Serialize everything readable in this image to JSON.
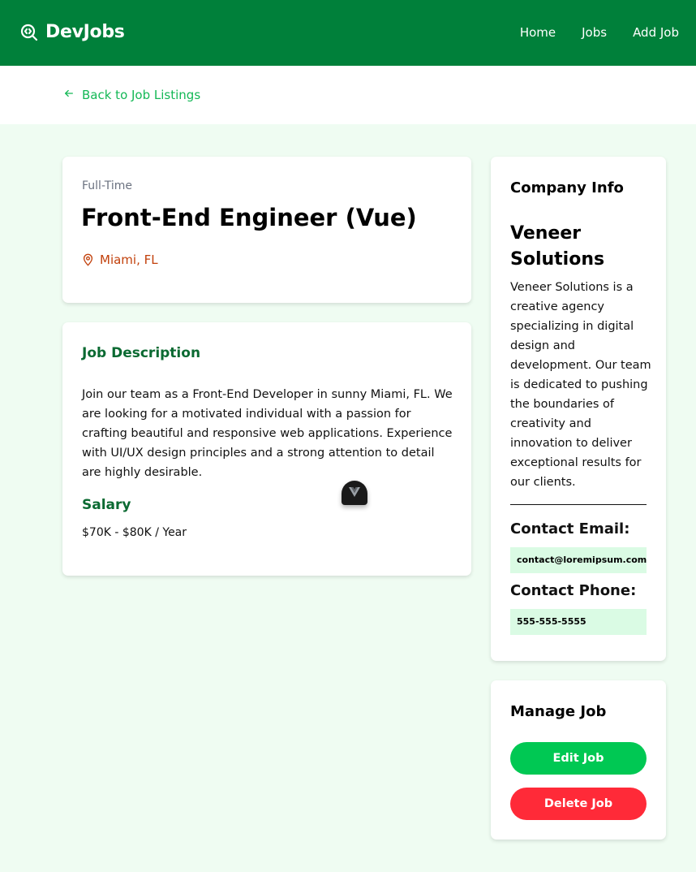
{
  "navbar": {
    "brand": "DevJobs",
    "links": [
      "Home",
      "Jobs",
      "Add Job"
    ]
  },
  "back_link": "Back to Job Listings",
  "job": {
    "type": "Full-Time",
    "title": "Front-End Engineer (Vue)",
    "location": "Miami, FL",
    "description_heading": "Job Description",
    "description": "Join our team as a Front-End Developer in sunny Miami, FL. We are looking for a motivated individual with a passion for crafting beautiful and responsive web applications. Experience with UI/UX design principles and a strong attention to detail are highly desirable.",
    "salary_heading": "Salary",
    "salary": "$70K - $80K / Year"
  },
  "company": {
    "heading": "Company Info",
    "name": "Veneer Solutions",
    "description": "Veneer Solutions is a creative agency specializing in digital design and development. Our team is dedicated to pushing the boundaries of creativity and innovation to deliver exceptional results for our clients.",
    "email_label": "Contact Email:",
    "email": "contact@loremipsum.com",
    "phone_label": "Contact Phone:",
    "phone": "555-555-5555"
  },
  "manage": {
    "heading": "Manage Job",
    "edit_label": "Edit Job",
    "delete_label": "Delete Job"
  },
  "colors": {
    "nav_bg": "#00803a",
    "accent": "#14b856",
    "heading_green": "#0b6a32",
    "location": "#c2410c",
    "edit_button": "#00c853",
    "delete_button": "#ff2a38",
    "page_bg": "#effcf2"
  },
  "icons": {
    "brand": "search-code-icon",
    "back": "arrow-left-icon",
    "location": "map-pin-icon",
    "devtools": "vue-logo-icon"
  }
}
